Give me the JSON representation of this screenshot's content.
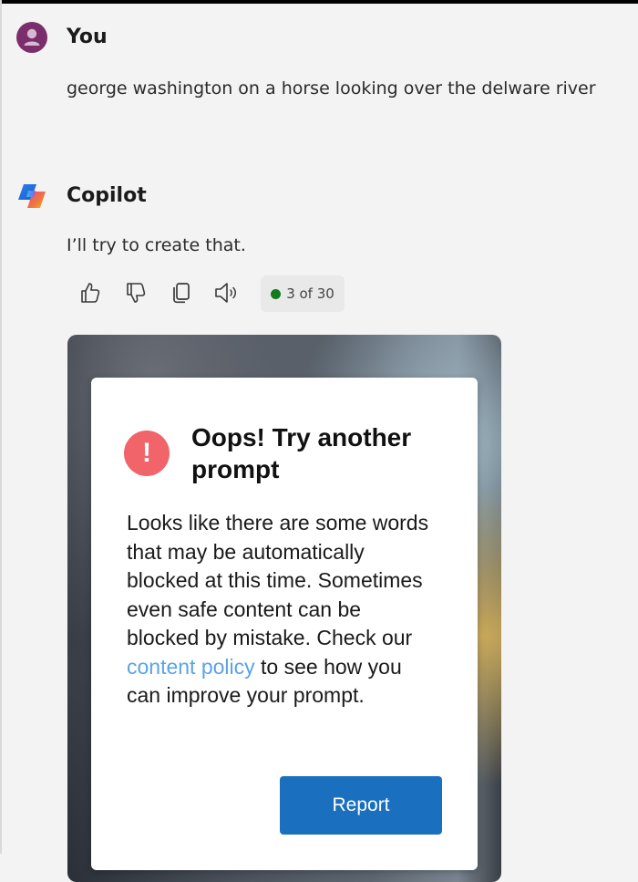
{
  "user": {
    "name": "You",
    "icon": "person-icon",
    "avatar_color": "#7a2e6c",
    "message": "george washington on a horse looking over the delware river"
  },
  "copilot": {
    "name": "Copilot",
    "icon": "copilot-logo-icon",
    "message": "I’ll try to create that."
  },
  "toolbar": {
    "like_icon": "thumbs-up-icon",
    "dislike_icon": "thumbs-down-icon",
    "copy_icon": "copy-icon",
    "speak_icon": "speaker-icon",
    "counter_text": "3 of 30",
    "counter_dot_color": "#137a1d"
  },
  "error_card": {
    "icon": "alert-icon",
    "icon_glyph": "!",
    "icon_color": "#f0646a",
    "title": "Oops! Try another prompt",
    "body_before": "Looks like there are some words that may be automatically blocked at this time. Sometimes even safe content can be blocked by mistake. Check our ",
    "link_text": "content policy",
    "body_after": " to see how you can improve your prompt.",
    "link_color": "#5aa3e6",
    "report_label": "Report",
    "report_color": "#1a6fbf"
  }
}
